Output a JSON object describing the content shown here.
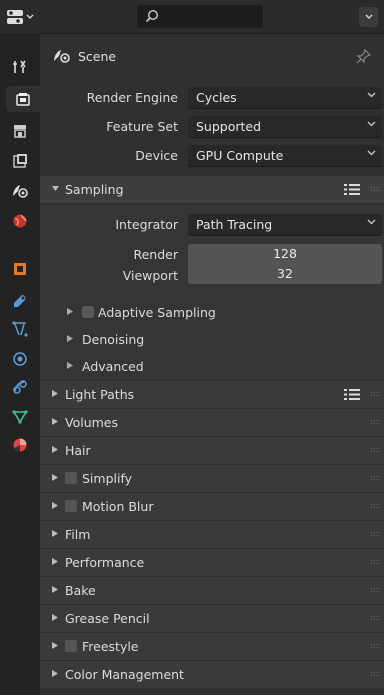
{
  "header": {
    "search_placeholder": ""
  },
  "context": {
    "label": "Scene"
  },
  "render": {
    "engine_label": "Render Engine",
    "engine_value": "Cycles",
    "feature_label": "Feature Set",
    "feature_value": "Supported",
    "device_label": "Device",
    "device_value": "GPU Compute"
  },
  "sampling": {
    "title": "Sampling",
    "integrator_label": "Integrator",
    "integrator_value": "Path Tracing",
    "render_label": "Render",
    "render_value": "128",
    "viewport_label": "Viewport",
    "viewport_value": "32",
    "sub": [
      "Adaptive Sampling",
      "Denoising",
      "Advanced"
    ]
  },
  "panels": [
    "Light Paths",
    "Volumes",
    "Hair",
    "Simplify",
    "Motion Blur",
    "Film",
    "Performance",
    "Bake",
    "Grease Pencil",
    "Freestyle",
    "Color Management"
  ],
  "icons": {
    "tabs": [
      "tool-icon",
      "render-icon",
      "output-icon",
      "view-layer-icon",
      "scene-icon",
      "world-icon",
      "object-icon",
      "modifier-icon",
      "particles-icon",
      "physics-icon",
      "constraints-icon",
      "object-data-icon",
      "material-icon"
    ]
  },
  "colors": {
    "accent": "#4a7fb5"
  }
}
